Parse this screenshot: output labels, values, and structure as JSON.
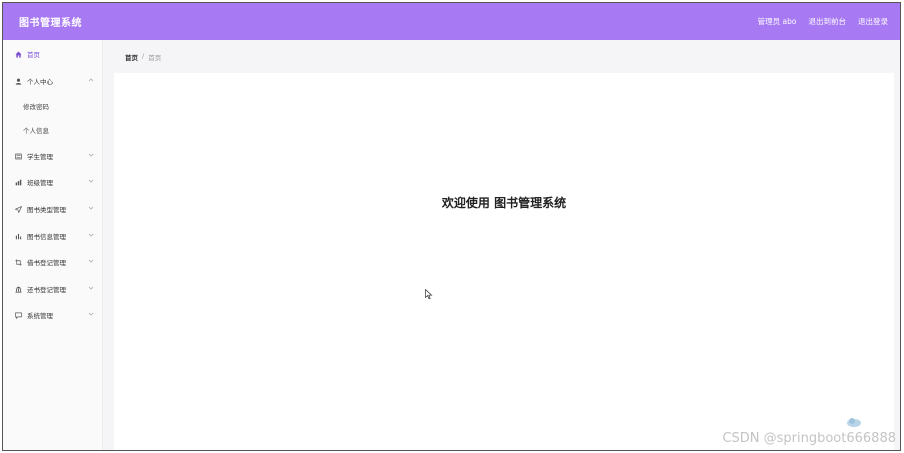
{
  "app": {
    "title": "图书管理系统"
  },
  "header": {
    "user_label": "管理员 abo",
    "back_label": "退出到前台",
    "logout_label": "退出登录"
  },
  "sidebar": {
    "items": [
      {
        "label": "首页",
        "icon": "home-icon",
        "active": true
      },
      {
        "label": "个人中心",
        "icon": "user-icon",
        "expanded": true,
        "children": [
          {
            "label": "修改密码"
          },
          {
            "label": "个人信息"
          }
        ]
      },
      {
        "label": "学生管理",
        "icon": "list-icon"
      },
      {
        "label": "班级管理",
        "icon": "chart-icon"
      },
      {
        "label": "图书类型管理",
        "icon": "send-icon"
      },
      {
        "label": "图书信息管理",
        "icon": "bar-chart-icon"
      },
      {
        "label": "借书登记管理",
        "icon": "crop-icon"
      },
      {
        "label": "还书登记管理",
        "icon": "bank-icon"
      },
      {
        "label": "系统管理",
        "icon": "message-icon"
      }
    ]
  },
  "breadcrumb": {
    "home": "首页",
    "separator": "/",
    "current": "首页"
  },
  "main": {
    "welcome_text": "欢迎使用 图书管理系统"
  },
  "watermark": "CSDN @springboot666888",
  "colors": {
    "header_bg": "#a779f2",
    "active": "#7b4fd6"
  }
}
